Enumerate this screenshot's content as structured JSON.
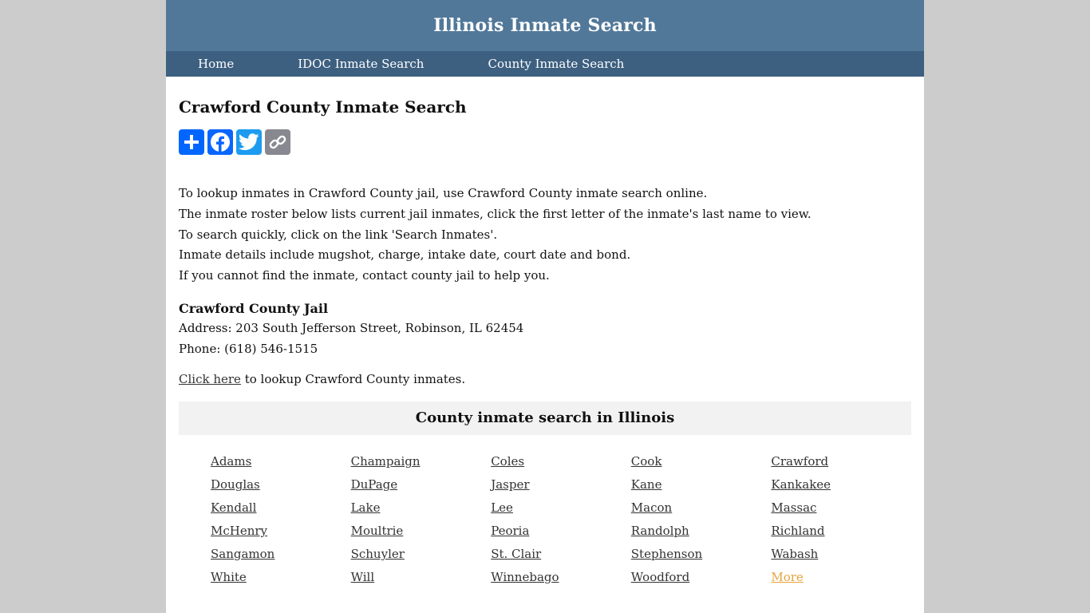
{
  "site": {
    "title": "Illinois Inmate Search"
  },
  "nav": {
    "items": [
      {
        "label": "Home"
      },
      {
        "label": "IDOC Inmate Search"
      },
      {
        "label": "County Inmate Search"
      }
    ]
  },
  "page": {
    "heading": "Crawford County Inmate Search",
    "share_buttons": [
      {
        "icon": "plus-icon",
        "label": "Share"
      },
      {
        "icon": "facebook-icon",
        "label": "Facebook"
      },
      {
        "icon": "twitter-icon",
        "label": "Twitter"
      },
      {
        "icon": "link-icon",
        "label": "Copy Link"
      }
    ],
    "intro_lines": [
      "To lookup inmates in Crawford County jail, use Crawford County inmate search online.",
      "The inmate roster below lists current jail inmates, click the first letter of the inmate's last name to view.",
      "To search quickly, click on the link 'Search Inmates'.",
      "Inmate details include mugshot, charge, intake date, court date and bond.",
      "If you cannot find the inmate, contact county jail to help you."
    ],
    "jail": {
      "name": "Crawford County Jail",
      "address": "Address: 203 South Jefferson Street, Robinson, IL 62454",
      "phone": "Phone: (618) 546-1515"
    },
    "lookup": {
      "link_label": "Click here",
      "text": " to lookup Crawford County inmates."
    }
  },
  "counties": {
    "heading": "County inmate search in Illinois",
    "items": [
      "Adams",
      "Champaign",
      "Coles",
      "Cook",
      "Crawford",
      "Douglas",
      "DuPage",
      "Jasper",
      "Kane",
      "Kankakee",
      "Kendall",
      "Lake",
      "Lee",
      "Macon",
      "Massac",
      "McHenry",
      "Moultrie",
      "Peoria",
      "Randolph",
      "Richland",
      "Sangamon",
      "Schuyler",
      "St. Clair",
      "Stephenson",
      "Wabash",
      "White",
      "Will",
      "Winnebago",
      "Woodford"
    ],
    "more_label": "More"
  },
  "colors": {
    "header_bg": "#527899",
    "nav_bg": "#3d5f80",
    "more_link": "#e8a33b",
    "share_blue": "#0166ff",
    "twitter_blue": "#1d9bf0",
    "link_gray": "#888990"
  }
}
